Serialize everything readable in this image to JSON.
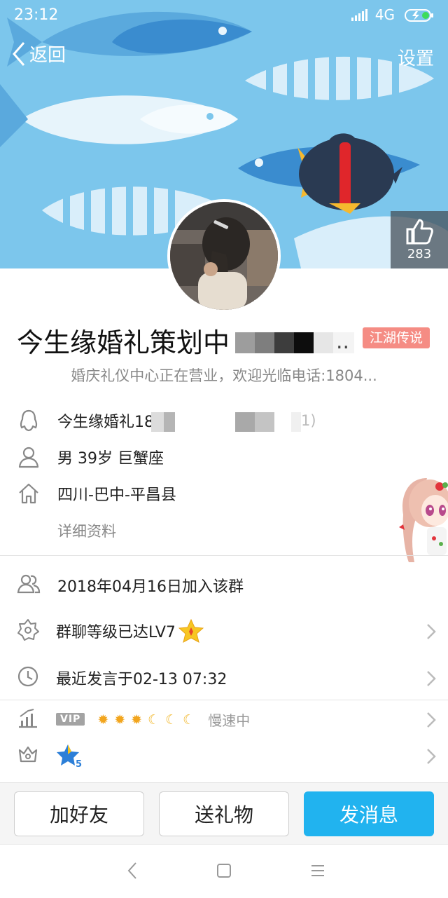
{
  "status_bar": {
    "time": "23:12",
    "network": "4G"
  },
  "nav": {
    "back_label": "返回",
    "settings_label": "设置"
  },
  "like": {
    "count": "283"
  },
  "profile": {
    "name": "今生缘婚礼策划中",
    "name_tail": "..",
    "badge": "江湖传说",
    "signature": "婚庆礼仪中心正在营业，欢迎光临电话:1804..."
  },
  "info": {
    "qq_name": "今生缘婚礼18",
    "qq_tail": "1)",
    "basic": "男  39岁  巨蟹座",
    "location": "四川-巴中-平昌县",
    "detail_link": "详细资料"
  },
  "group": {
    "joined": "2018年04月16日加入该群",
    "level": "群聊等级已达LV7",
    "last_speak": "最近发言于02-13 07:32"
  },
  "vip": {
    "tag": "VIP",
    "level_icons": [
      "sun",
      "sun",
      "sun",
      "moon",
      "moon",
      "moon"
    ],
    "speed": "慢速中",
    "star_level": "5"
  },
  "actions": {
    "add_friend": "加好友",
    "send_gift": "送礼物",
    "send_message": "发消息"
  },
  "colors": {
    "accent": "#21b3ef",
    "badge": "#f58c84",
    "banner": "#7cc6ec"
  }
}
